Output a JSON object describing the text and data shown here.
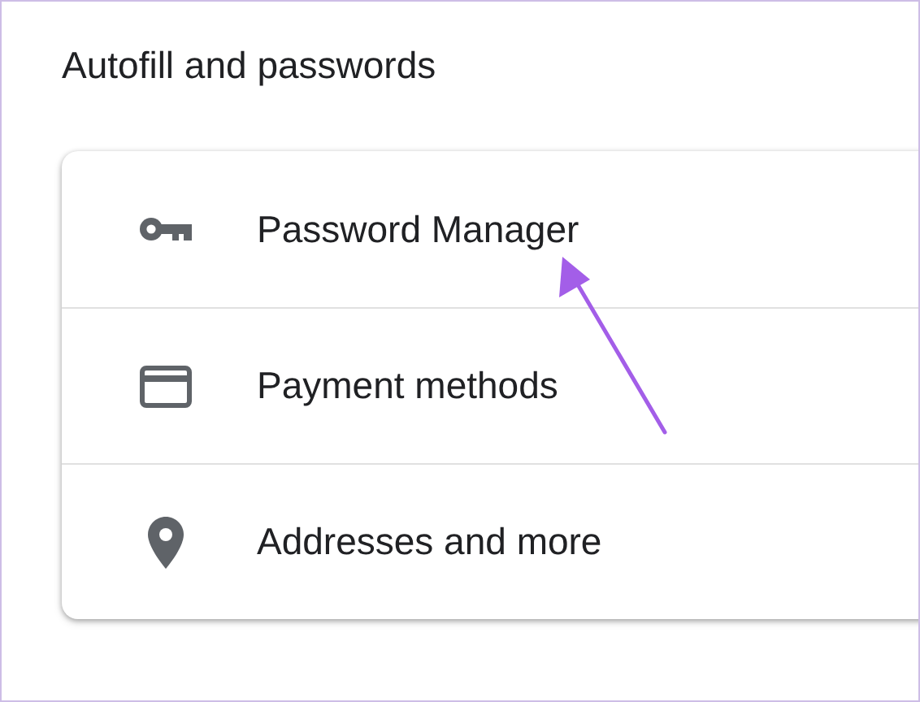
{
  "section": {
    "title": "Autofill and passwords"
  },
  "items": [
    {
      "label": "Password Manager",
      "kind": "key"
    },
    {
      "label": "Payment methods",
      "kind": "card"
    },
    {
      "label": "Addresses and more",
      "kind": "pin"
    }
  ]
}
